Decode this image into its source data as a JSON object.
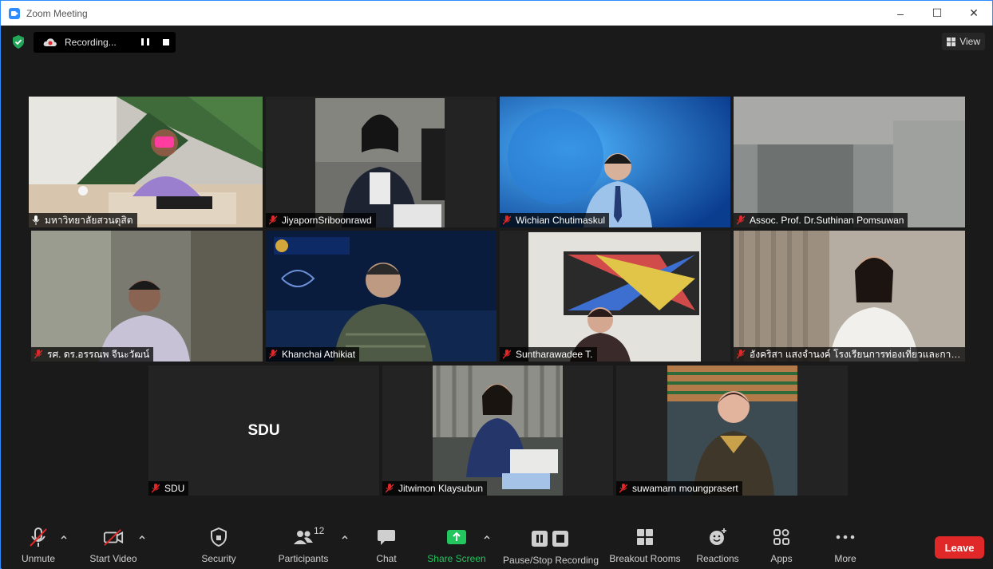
{
  "window": {
    "title": "Zoom Meeting",
    "controls": [
      "–",
      "☐",
      "✕"
    ]
  },
  "recording": {
    "status": "Recording..."
  },
  "view": {
    "label": "View"
  },
  "tiles": [
    {
      "name": "มหาวิทยาลัยสวนดุสิต",
      "muted": false,
      "active": true
    },
    {
      "name": "JiyapornSriboonrawd",
      "muted": true
    },
    {
      "name": "Wichian Chutimaskul",
      "muted": true
    },
    {
      "name": "Assoc. Prof. Dr.Suthinan Pomsuwan",
      "muted": true
    },
    {
      "name": "รศ. ดร.อรรณพ จีนะวัฒน์",
      "muted": true
    },
    {
      "name": "Khanchai Athikiat",
      "muted": true
    },
    {
      "name": "Suntharawadee T.",
      "muted": true
    },
    {
      "name": "อังคริสา แสงจำนงค์ โรงเรียนการท่องเที่ยวและการบริ...",
      "muted": true
    },
    {
      "name": "SDU",
      "muted": true,
      "placeholder": "SDU"
    },
    {
      "name": "Jitwimon Klaysubun",
      "muted": true
    },
    {
      "name": "suwamarn moungprasert",
      "muted": true
    }
  ],
  "toolbar": {
    "unmute": "Unmute",
    "start_video": "Start Video",
    "security": "Security",
    "participants": "Participants",
    "participants_count": "12",
    "chat": "Chat",
    "share_screen": "Share Screen",
    "pause_stop_recording": "Pause/Stop Recording",
    "breakout_rooms": "Breakout Rooms",
    "reactions": "Reactions",
    "apps": "Apps",
    "more": "More",
    "leave": "Leave"
  },
  "colors": {
    "accent": "#2d8cff",
    "active_speaker": "#d6ee5b",
    "share_green": "#22c55e",
    "leave_red": "#e02828",
    "muted_red": "#e02828"
  }
}
